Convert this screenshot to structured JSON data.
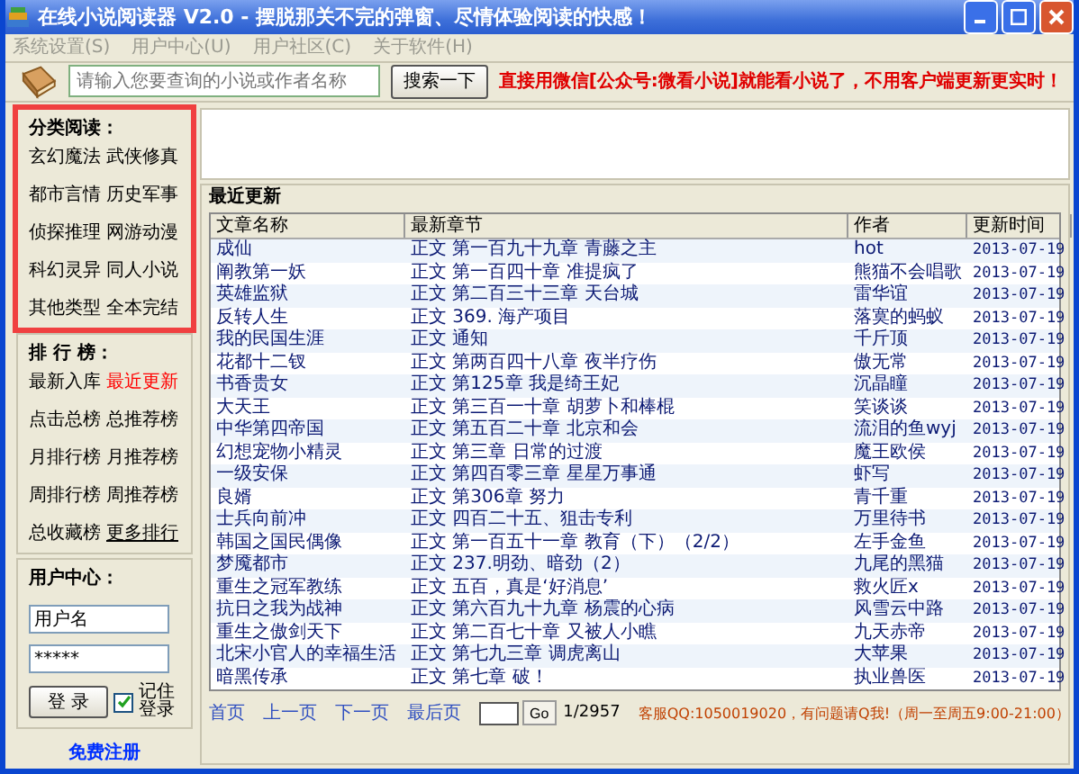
{
  "window": {
    "title": "在线小说阅读器 V2.0 - 摆脱那关不完的弹窗、尽情体验阅读的快感！"
  },
  "menu": [
    "系统设置(S)",
    "用户中心(U)",
    "用户社区(C)",
    "关于软件(H)"
  ],
  "search": {
    "placeholder": "请输入您要查询的小说或作者名称",
    "button": "搜索一下",
    "notice": "直接用微信[公众号:微看小说]就能看小说了，不用客户端更新更实时！"
  },
  "categories": {
    "title": "分类阅读：",
    "items": [
      "玄幻魔法",
      "武侠修真",
      "都市言情",
      "历史军事",
      "侦探推理",
      "网游动漫",
      "科幻灵异",
      "同人小说",
      "其他类型",
      "全本完结"
    ]
  },
  "rankings": {
    "title": "排 行 榜：",
    "items": [
      {
        "label": "最新入库",
        "kind": "normal"
      },
      {
        "label": "最近更新",
        "kind": "highlight"
      },
      {
        "label": "点击总榜",
        "kind": "normal"
      },
      {
        "label": "总推荐榜",
        "kind": "normal"
      },
      {
        "label": "月排行榜",
        "kind": "normal"
      },
      {
        "label": "月推荐榜",
        "kind": "normal"
      },
      {
        "label": "周排行榜",
        "kind": "normal"
      },
      {
        "label": "周推荐榜",
        "kind": "normal"
      },
      {
        "label": "总收藏榜",
        "kind": "normal"
      },
      {
        "label": "更多排行",
        "kind": "link"
      }
    ]
  },
  "user_center": {
    "title": "用户中心：",
    "username": "用户名",
    "password": "*****",
    "login": "登 录",
    "remember": {
      "label": "记住登录",
      "checked": true
    },
    "register": "免费注册"
  },
  "recent": {
    "title": "最近更新",
    "columns": [
      "文章名称",
      "最新章节",
      "作者",
      "更新时间"
    ],
    "rows": [
      [
        "成仙",
        "正文 第一百九十九章 青藤之主",
        "hot",
        "2013-07-19"
      ],
      [
        "阐教第一妖",
        "正文 第一百四十章 准提疯了",
        "熊猫不会唱歌",
        "2013-07-19"
      ],
      [
        "英雄监狱",
        "正文 第二百三十三章 天台城",
        "雷华谊",
        "2013-07-19"
      ],
      [
        "反转人生",
        "正文 369. 海产项目",
        "落寞的蚂蚁",
        "2013-07-19"
      ],
      [
        "我的民国生涯",
        "正文 通知",
        "千斤顶",
        "2013-07-19"
      ],
      [
        "花都十二钗",
        "正文 第两百四十八章 夜半疗伤",
        "傲无常",
        "2013-07-19"
      ],
      [
        "书香贵女",
        "正文 第125章 我是绮王妃",
        "沉晶瞳",
        "2013-07-19"
      ],
      [
        "大天王",
        "正文 第三百一十章 胡萝卜和棒棍",
        "笑谈谈",
        "2013-07-19"
      ],
      [
        "中华第四帝国",
        "正文 第五百二十章 北京和会",
        "流泪的鱼wyj",
        "2013-07-19"
      ],
      [
        "幻想宠物小精灵",
        "正文 第三章 日常的过渡",
        "魔王欧侯",
        "2013-07-19"
      ],
      [
        "一级安保",
        "正文 第四百零三章 星星万事通",
        "虾写",
        "2013-07-19"
      ],
      [
        "良婿",
        "正文 第306章 努力",
        "青千重",
        "2013-07-19"
      ],
      [
        "士兵向前冲",
        "正文 四百二十五、狙击专利",
        "万里待书",
        "2013-07-19"
      ],
      [
        "韩国之国民偶像",
        "正文 第一百五十一章 教育（下）（2/2）",
        "左手金鱼",
        "2013-07-19"
      ],
      [
        "梦魇都市",
        "正文 237.明劲、暗劲（2）",
        "九尾的黑猫",
        "2013-07-19"
      ],
      [
        "重生之冠军教练",
        "正文 五百，真是‘好消息’",
        "救火匠x",
        "2013-07-19"
      ],
      [
        "抗日之我为战神",
        "正文 第六百九十九章 杨震的心病",
        "风雪云中路",
        "2013-07-19"
      ],
      [
        "重生之傲剑天下",
        "正文 第二百七十章 又被人小瞧",
        "九天赤帝",
        "2013-07-19"
      ],
      [
        "北宋小官人的幸福生活",
        "正文 第七九三章 调虎离山",
        "大苹果",
        "2013-07-19"
      ],
      [
        "暗黑传承",
        "正文 第七章 破！",
        "执业兽医",
        "2013-07-19"
      ]
    ]
  },
  "pager": {
    "links": [
      "首页",
      "上一页",
      "下一页",
      "最后页"
    ],
    "go": "Go",
    "pages": "1/2957",
    "contact": "客服QQ:1050019020，有问题请Q我!（周一至周五9:00-21:00）"
  }
}
